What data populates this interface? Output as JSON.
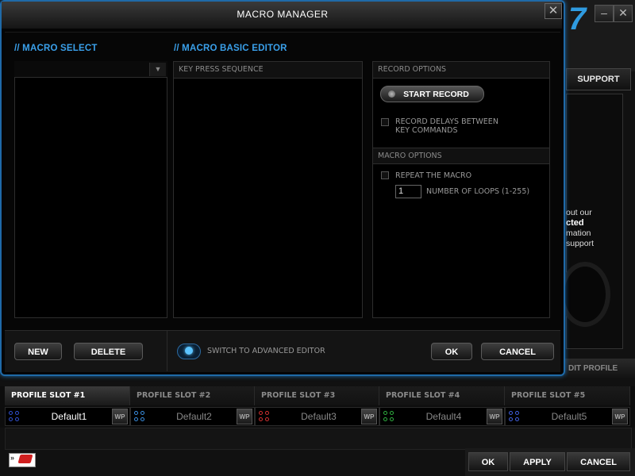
{
  "background": {
    "support_tab": "SUPPORT",
    "support_text": [
      "out our",
      "cted",
      "mation",
      "support"
    ],
    "edit_profile": "DIT PROFILE",
    "logo_glyph": "7"
  },
  "dialog": {
    "title": "MACRO MANAGER",
    "close_glyph": "✕",
    "macro_select": {
      "title": "// MACRO SELECT",
      "dropdown_value": "",
      "dropdown_icon": "chevron-down-icon"
    },
    "basic_editor": {
      "title": "// MACRO BASIC EDITOR",
      "sequence_header": "KEY PRESS SEQUENCE"
    },
    "record_options": {
      "header": "RECORD OPTIONS",
      "start_record": "START RECORD",
      "record_delays_line1": "RECORD DELAYS BETWEEN",
      "record_delays_line2": "KEY COMMANDS"
    },
    "macro_options": {
      "header": "MACRO OPTIONS",
      "repeat": "REPEAT THE MACRO",
      "loops_value": "1",
      "loops_label": "NUMBER OF LOOPS (1-255)"
    },
    "footer": {
      "new": "NEW",
      "delete": "DELETE",
      "switch_advanced": "SWITCH TO ADVANCED EDITOR",
      "ok": "OK",
      "cancel": "CANCEL"
    }
  },
  "profiles": [
    {
      "slot": "PROFILE SLOT #1",
      "name": "Default1",
      "wp": "WP",
      "color": "#3050d0",
      "active": true
    },
    {
      "slot": "PROFILE SLOT #2",
      "name": "Default2",
      "wp": "WP",
      "color": "#3a8ee0",
      "active": false
    },
    {
      "slot": "PROFILE SLOT #3",
      "name": "Default3",
      "wp": "WP",
      "color": "#d03030",
      "active": false
    },
    {
      "slot": "PROFILE SLOT #4",
      "name": "Default4",
      "wp": "WP",
      "color": "#30b040",
      "active": false
    },
    {
      "slot": "PROFILE SLOT #5",
      "name": "Default5",
      "wp": "WP",
      "color": "#4060e0",
      "active": false
    }
  ],
  "bottom_bar": {
    "ok": "OK",
    "apply": "APPLY",
    "cancel": "CANCEL",
    "flag_arrow": "»"
  },
  "colors": {
    "accent": "#3aa0ea",
    "dialog_border": "#1f6aa8"
  }
}
